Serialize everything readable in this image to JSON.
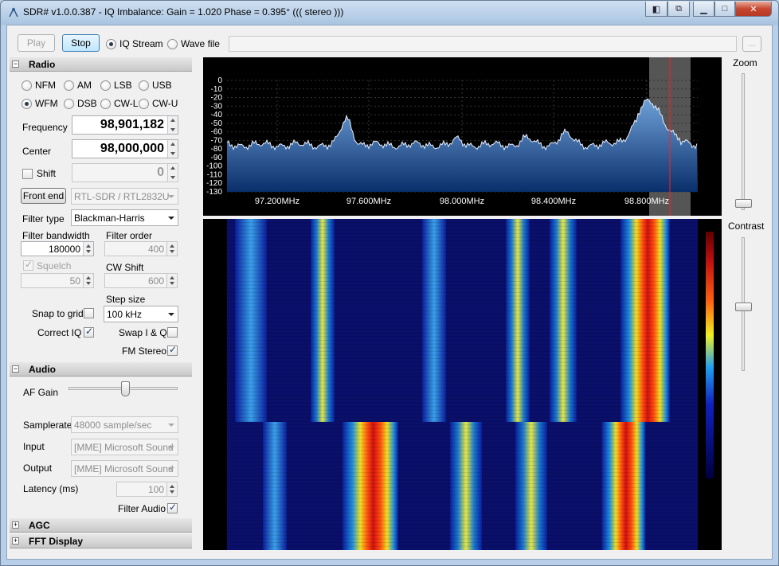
{
  "window": {
    "title": "SDR# v1.0.0.387 - IQ Imbalance: Gain = 1.020 Phase = 0.395° ((( stereo )))"
  },
  "toolbar": {
    "play_label": "Play",
    "stop_label": "Stop",
    "iq_stream_label": "IQ Stream",
    "wave_file_label": "Wave file",
    "browse_label": "...",
    "source_selected": "IQ Stream"
  },
  "radio": {
    "section_title": "Radio",
    "modes": [
      "NFM",
      "AM",
      "LSB",
      "USB",
      "WFM",
      "DSB",
      "CW-L",
      "CW-U"
    ],
    "selected_mode": "WFM",
    "frequency_label": "Frequency",
    "frequency_value": "98,901,182",
    "center_label": "Center",
    "center_value": "98,000,000",
    "shift_label": "Shift",
    "shift_value": "0",
    "front_end_label": "Front end",
    "front_end_value": "RTL-SDR / RTL2832U",
    "filter_type_label": "Filter type",
    "filter_type_value": "Blackman-Harris",
    "filter_bandwidth_label": "Filter bandwidth",
    "filter_bandwidth_value": "180000",
    "filter_order_label": "Filter order",
    "filter_order_value": "400",
    "squelch_label": "Squelch",
    "squelch_value": "50",
    "cw_shift_label": "CW Shift",
    "cw_shift_value": "600",
    "step_size_label": "Step size",
    "step_size_value": "100 kHz",
    "snap_to_grid_label": "Snap to grid",
    "correct_iq_label": "Correct IQ",
    "swap_iq_label": "Swap I & Q",
    "fm_stereo_label": "FM Stereo"
  },
  "audio": {
    "section_title": "Audio",
    "af_gain_label": "AF Gain",
    "af_gain_level": 0.52,
    "samplerate_label": "Samplerate",
    "samplerate_value": "48000 sample/sec",
    "input_label": "Input",
    "input_value": "[MME] Microsoft Sound",
    "output_label": "Output",
    "output_value": "[MME] Microsoft Sound",
    "latency_label": "Latency (ms)",
    "latency_value": "100",
    "filter_audio_label": "Filter Audio"
  },
  "collapsed_sections": [
    "AGC",
    "FFT Display"
  ],
  "spectrum": {
    "db_ticks": [
      "0",
      "-10",
      "-20",
      "-30",
      "-40",
      "-50",
      "-60",
      "-70",
      "-80",
      "-90",
      "-100",
      "-110",
      "-120",
      "-130"
    ],
    "freq_ticks": [
      "97.200MHz",
      "97.600MHz",
      "98.000MHz",
      "98.400MHz",
      "98.800MHz"
    ]
  },
  "side": {
    "zoom_label": "Zoom",
    "contrast_label": "Contrast",
    "zoom_level": 0.05,
    "contrast_level": 0.48
  },
  "colors": {
    "spectrum_fill": "#2f6fb3",
    "tuned_line": "#ff2020",
    "waterfall_bg": "#0a0f6a"
  }
}
